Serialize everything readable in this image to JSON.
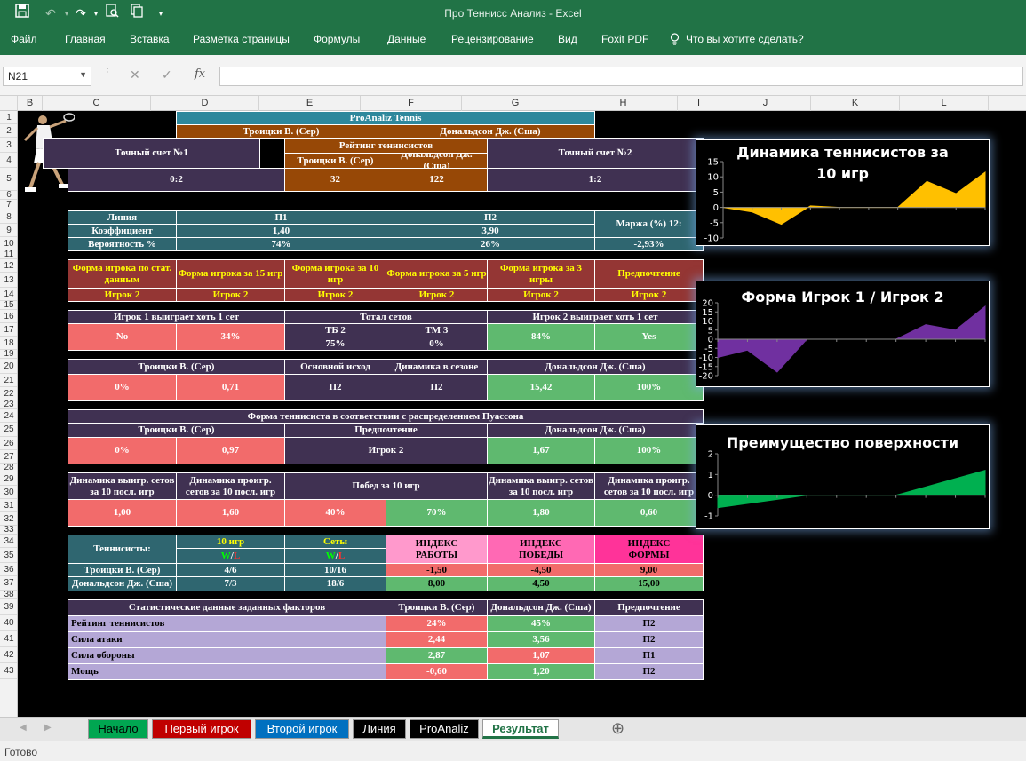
{
  "window": {
    "title": "Про Теннисс Анализ - Excel"
  },
  "ribbon": {
    "tabs": [
      "Файл",
      "Главная",
      "Вставка",
      "Разметка страницы",
      "Формулы",
      "Данные",
      "Рецензирование",
      "Вид",
      "Foxit PDF"
    ],
    "tell_me": "Что вы хотите сделать?"
  },
  "formula_bar": {
    "name_box": "N21",
    "cancel_glyph": "✕",
    "enter_glyph": "✓",
    "fx_label": "fx"
  },
  "columns": [
    "B",
    "C",
    "D",
    "E",
    "F",
    "G",
    "H",
    "I",
    "J",
    "K",
    "L"
  ],
  "rows": [
    "1",
    "2",
    "3",
    "4",
    "5",
    "6",
    "7",
    "8",
    "9",
    "10",
    "11",
    "12",
    "13",
    "14",
    "15",
    "16",
    "17",
    "18",
    "19",
    "20",
    "21",
    "22",
    "23",
    "24",
    "25",
    "26",
    "27",
    "28",
    "29",
    "30",
    "31",
    "32",
    "33",
    "34",
    "35",
    "36",
    "37",
    "38",
    "39",
    "40",
    "41",
    "42",
    "43"
  ],
  "sheet": {
    "title": "ProAnaliz Tennis",
    "player1": "Троицки В. (Сер)",
    "player2": "Дональдсон Дж. (Сша)",
    "exact1": "Точный счет №1",
    "exact2": "Точный счет №2",
    "rating_head": "Рейтинг теннисистов",
    "score1": "0:2",
    "rank1": "32",
    "rank2": "122",
    "score2": "1:2",
    "line": "Линия",
    "coef": "Коэффициент",
    "prob": "Вероятность %",
    "p1": "П1",
    "p2": "П2",
    "coef1": "1,40",
    "coef2": "3,90",
    "prob1": "74%",
    "prob2": "26%",
    "margin_label": "Маржа (%) 12:",
    "margin_val": "-2,93%",
    "form_stat": "Форма игрока по стат. данным",
    "form15": "Форма игрока за 15 игр",
    "form10": "Форма игрока за 10 игр",
    "form5": "Форма игрока за 5 игр",
    "form3": "Форма игрока за 3 игры",
    "preference": "Предпочтение",
    "player_2": "Игрок 2",
    "p1_win_set": "Игрок 1 выиграет хоть 1 сет",
    "total_sets": "Тотал сетов",
    "p2_win_set": "Игрок 2 выиграет хоть 1 сет",
    "no": "No",
    "pct34": "34%",
    "tb": "ТБ 2",
    "tm": "ТМ 3",
    "tb_val": "75%",
    "tm_val": "0%",
    "pct84": "84%",
    "yes": "Yes",
    "main_outcome": "Основной исход",
    "season_dyn": "Динамика в сезоне",
    "pct0": "0%",
    "v071": "0,71",
    "v1542": "15,42",
    "pct100": "100%",
    "poisson": "Форма теннисиста в соответствии с распределением Пуассона",
    "v097": "0,97",
    "v167": "1,67",
    "dyn_win": "Динамика выигр. сетов за 10 посл. игр",
    "dyn_lose": "Динамика проигр. сетов за 10 посл. игр",
    "wins10": "Побед за 10 игр",
    "v100": "1,00",
    "v160": "1,60",
    "pct40": "40%",
    "pct70": "70%",
    "v180": "1,80",
    "v060": "0,60",
    "players": "Теннисисты:",
    "games10": "10 игр",
    "sets": "Сеты",
    "w": "W",
    "slash": "/",
    "l": "L",
    "idx_work": "ИНДЕКС РАБОТЫ",
    "idx_win": "ИНДЕКС ПОБЕДЫ",
    "idx_form": "ИНДЕКС ФОРМЫ",
    "g1": "4/6",
    "s1": "10/16",
    "iw1": "-1,50",
    "iv1": "-4,50",
    "if1": "9,00",
    "g2": "7/3",
    "s2": "18/6",
    "iw2": "8,00",
    "iv2": "4,50",
    "if2": "15,00",
    "stats_head": "Статистические данные заданных факторов",
    "r_rating": "Рейтинг теннисистов",
    "r_attack": "Сила атаки",
    "r_defense": "Сила обороны",
    "r_power": "Мощь",
    "st_r1": "24%",
    "st_r2": "45%",
    "st_rp": "П2",
    "st_a1": "2,44",
    "st_a2": "3,56",
    "st_ap": "П2",
    "st_d1": "2,87",
    "st_d2": "1,07",
    "st_dp": "П1",
    "st_m1": "-0,60",
    "st_m2": "1,20",
    "st_mp": "П2"
  },
  "chart_data": [
    {
      "type": "area",
      "title": "Динамика теннисистов за 10 игр",
      "x": [
        1,
        2,
        3,
        4,
        5,
        6,
        7,
        8,
        9,
        10
      ],
      "series": [
        {
          "values": [
            0,
            -1.5,
            -5.5,
            0.5,
            0,
            0,
            0,
            8.5,
            4.5,
            11.5
          ]
        }
      ],
      "ylim": [
        -10,
        15
      ],
      "yticks": [
        -10,
        -5,
        0,
        5,
        10,
        15
      ],
      "color": "#ffc000"
    },
    {
      "type": "area",
      "title": "Форма Игрок 1 / Игрок 2",
      "x": [
        1,
        2,
        3,
        4,
        5,
        6,
        7,
        8,
        9,
        10
      ],
      "series": [
        {
          "values": [
            -10,
            -6,
            -18,
            0,
            0,
            0,
            0,
            8,
            5,
            18
          ]
        }
      ],
      "ylim": [
        -20,
        20
      ],
      "yticks": [
        -20,
        -15,
        -10,
        -5,
        0,
        5,
        10,
        15,
        20
      ],
      "color": "#7030a0"
    },
    {
      "type": "area",
      "title": "Преимущество поверхности",
      "x": [
        1,
        2,
        3,
        4,
        5,
        6,
        7,
        8,
        9,
        10
      ],
      "series": [
        {
          "values": [
            -0.6,
            -0.4,
            -0.2,
            0,
            0,
            0,
            0,
            0.4,
            0.8,
            1.2
          ]
        }
      ],
      "ylim": [
        -1,
        2
      ],
      "yticks": [
        -1,
        0,
        1,
        2
      ],
      "color": "#00b050"
    }
  ],
  "sheet_tabs": [
    {
      "label": "Начало",
      "bg": "#00a651",
      "fg": "#000"
    },
    {
      "label": "Первый игрок",
      "bg": "#c00000",
      "fg": "#fff"
    },
    {
      "label": "Второй игрок",
      "bg": "#0070c0",
      "fg": "#fff"
    },
    {
      "label": "Линия",
      "bg": "#000000",
      "fg": "#fff"
    },
    {
      "label": "ProAnaliz",
      "bg": "#000000",
      "fg": "#fff"
    },
    {
      "label": "Результат",
      "bg": "#ffffff",
      "fg": "#217346",
      "active": true
    }
  ],
  "add_sheet_glyph": "⊕",
  "status": "Готово"
}
